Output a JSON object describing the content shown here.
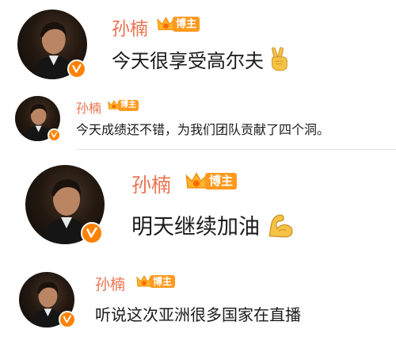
{
  "colors": {
    "username": "#eb7350",
    "badge": "#ff8200",
    "tag": "#ff9a1f",
    "text": "#1a1a1a",
    "separator": "#e6e6e6"
  },
  "posts": [
    {
      "username": "孙楠",
      "tag_label": "博主",
      "avatar_icon": "user-avatar-photo",
      "verified_icon": "verified-v-icon",
      "message": "今天很享受高尔夫",
      "emoji_icon": "victory-hand-icon"
    },
    {
      "username": "孙楠",
      "tag_label": "博主",
      "avatar_icon": "user-avatar-photo",
      "verified_icon": "verified-v-icon",
      "message": "今天成绩还不错，为我们团队贡献了四个洞。",
      "emoji_icon": ""
    },
    {
      "username": "孙楠",
      "tag_label": "博主",
      "avatar_icon": "user-avatar-photo",
      "verified_icon": "verified-v-icon",
      "message": "明天继续加油",
      "emoji_icon": "flexed-biceps-icon"
    },
    {
      "username": "孙楠",
      "tag_label": "博主",
      "avatar_icon": "user-avatar-photo",
      "verified_icon": "verified-v-icon",
      "message": "听说这次亚洲很多国家在直播",
      "emoji_icon": ""
    }
  ]
}
